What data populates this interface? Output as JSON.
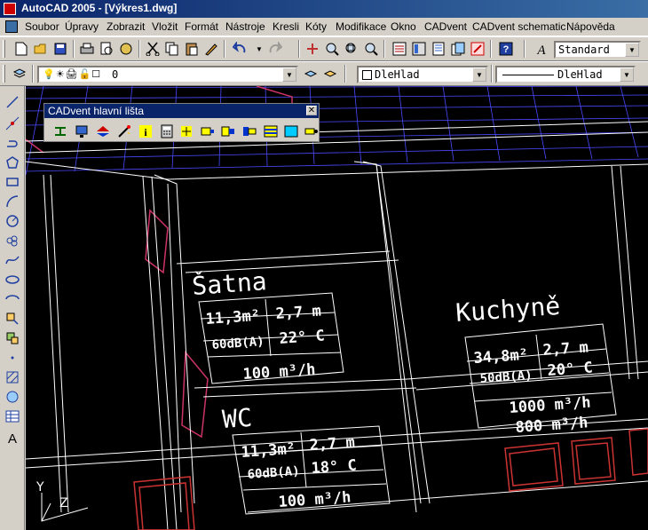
{
  "window": {
    "title": "AutoCAD 2005 - [Výkres1.dwg]"
  },
  "menu": [
    "Soubor",
    "Úpravy",
    "Zobrazit",
    "Vložit",
    "Formát",
    "Nástroje",
    "Kresli",
    "Kóty",
    "Modifikace",
    "Okno",
    "CADvent",
    "CADvent schematic",
    "Nápověda"
  ],
  "standard_toolbar": {
    "text_style": "Standard"
  },
  "layers_toolbar": {
    "layer": "0",
    "color": "DleHlad",
    "linetype": "DleHlad"
  },
  "cadvent_panel": {
    "title": "CADvent hlavní lišta"
  },
  "drawing": {
    "ucs": {
      "y": "Y",
      "z": "Z"
    },
    "rooms": [
      {
        "name": "Šatna",
        "area": "11,3m²",
        "height": "2,7 m",
        "noise": "60dB(A)",
        "temp": "22° C",
        "flows": [
          "100 m³/h"
        ]
      },
      {
        "name": "Kuchyně",
        "area": "34,8m²",
        "height": "2,7 m",
        "noise": "50dB(A)",
        "temp": "20° C",
        "flows": [
          "1000 m³/h",
          "800 m³/h"
        ]
      },
      {
        "name": "WC",
        "area": "11,3m²",
        "height": "2,7 m",
        "noise": "60dB(A)",
        "temp": "18° C",
        "flows": [
          "100 m³/h"
        ]
      }
    ]
  },
  "colors": {
    "title_bar": "#0a246a",
    "canvas": "#000000",
    "grid": "#4a4aff",
    "lines": "#ffffff",
    "furniture": "#cc2222"
  }
}
